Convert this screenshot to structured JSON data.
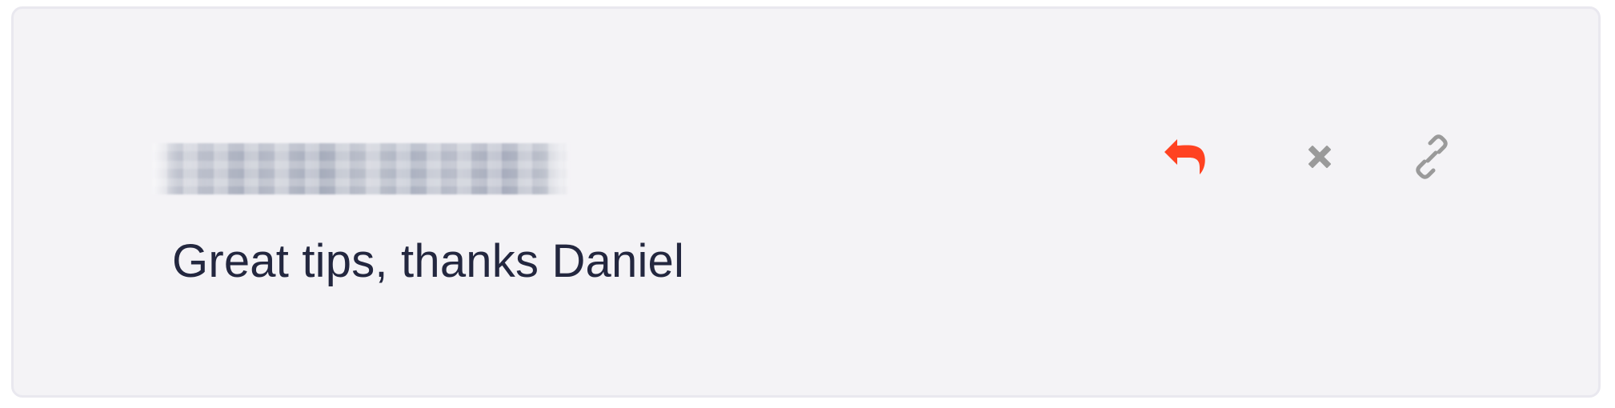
{
  "card": {
    "message": "Great tips, thanks Daniel"
  },
  "icons": {
    "reply": "reply-icon",
    "close": "close-icon",
    "link": "link-icon"
  },
  "colors": {
    "card_background": "#f4f3f6",
    "card_border": "#e9e8ef",
    "text": "#23273f",
    "reply": "#ff4221",
    "muted_icon": "#9a9a9a"
  }
}
